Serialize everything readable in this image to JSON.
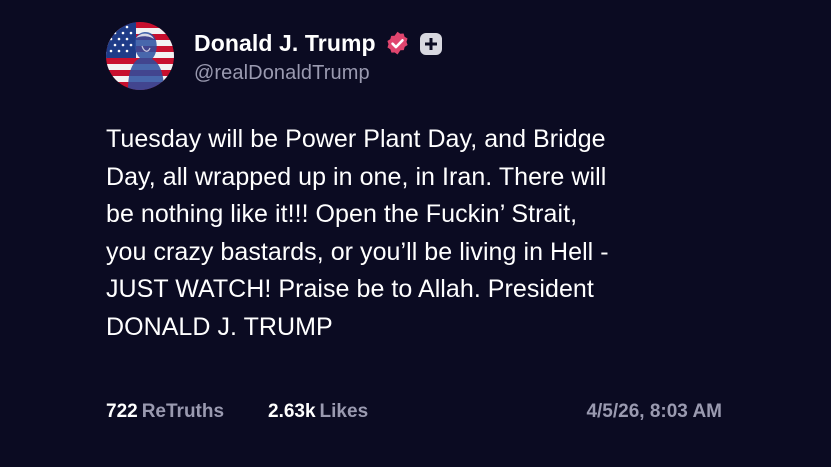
{
  "post": {
    "author": {
      "display_name": "Donald J. Trump",
      "handle": "@realDonaldTrump",
      "verified": true,
      "avatar_icon": "flag-portrait-avatar",
      "follow_icon": "plus-icon"
    },
    "body": "Tuesday will be Power Plant Day, and Bridge\nDay, all wrapped up in one, in Iran. There will\nbe nothing like it!!! Open the Fuckin’ Strait,\nyou crazy bastards, or you’ll be living in Hell -\nJUST WATCH! Praise be to Allah. President\nDONALD J. TRUMP",
    "stats": {
      "retruths_count": "722",
      "retruths_label": "ReTruths",
      "likes_count": "2.63k",
      "likes_label": "Likes"
    },
    "timestamp": "4/5/26, 8:03 AM"
  },
  "colors": {
    "background": "#0b0b22",
    "text": "#ffffff",
    "muted": "#9a9ab0",
    "verified_badge": "#e0456e"
  }
}
